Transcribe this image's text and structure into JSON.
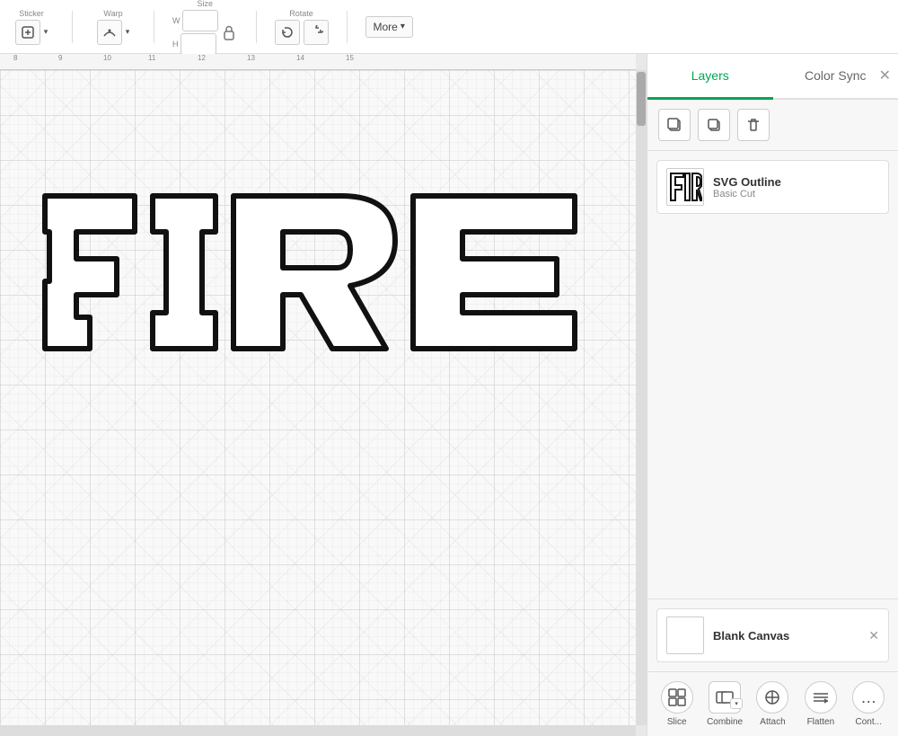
{
  "toolbar": {
    "sticker_label": "Sticker",
    "warp_label": "Warp",
    "size_label": "Size",
    "rotate_label": "Rotate",
    "more_label": "More",
    "more_arrow": "▾",
    "size_w_placeholder": "W",
    "size_h_placeholder": "H",
    "lock_icon": "🔒"
  },
  "tabs": {
    "layers_label": "Layers",
    "color_sync_label": "Color Sync",
    "active": "layers"
  },
  "panel": {
    "duplicate_icon": "⧉",
    "copy_icon": "⧉",
    "delete_icon": "🗑"
  },
  "layers": [
    {
      "name": "SVG Outline",
      "type": "Basic Cut",
      "thumbnail": "fire_outline"
    }
  ],
  "blank_canvas": {
    "label": "Blank Canvas"
  },
  "actions": {
    "slice_label": "Slice",
    "combine_label": "Combine",
    "attach_label": "Attach",
    "flatten_label": "Flatten",
    "cont_label": "Cont..."
  },
  "ruler": {
    "marks": [
      "8",
      "9",
      "10",
      "11",
      "12",
      "13",
      "14",
      "15"
    ]
  },
  "colors": {
    "active_tab": "#00a651",
    "panel_bg": "#f7f7f7",
    "canvas_bg": "#f9f9f9",
    "toolbar_bg": "#ffffff"
  }
}
